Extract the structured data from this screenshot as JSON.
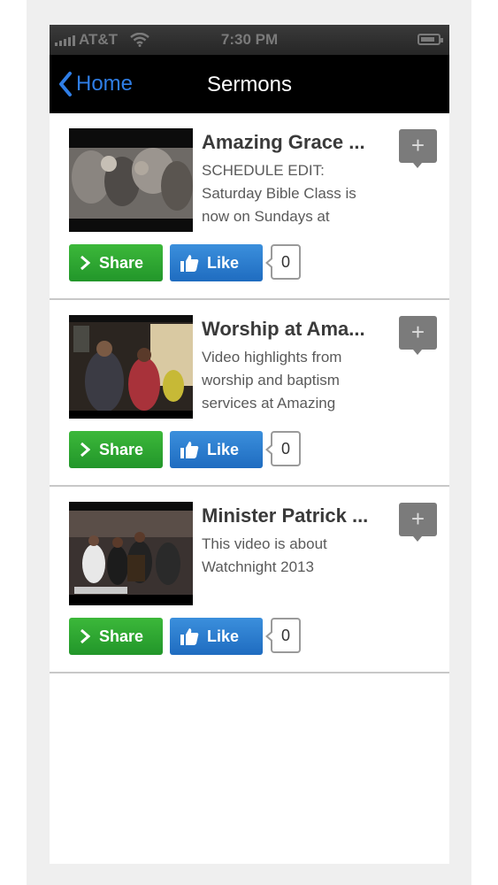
{
  "status_bar": {
    "carrier": "AT&T",
    "time": "7:30 PM",
    "icons": [
      "signal-icon",
      "wifi-icon",
      "battery-icon"
    ]
  },
  "nav": {
    "back_label": "Home",
    "title": "Sermons",
    "back_icon": "chevron-left-icon"
  },
  "colors": {
    "nav_bg": "#000000",
    "back_link": "#2f7ee6",
    "share_green": "#2ca634",
    "like_blue": "#2a7ccd",
    "add_gray": "#7b7b7b"
  },
  "sermons": [
    {
      "title": "Amazing Grace ...",
      "description": "SCHEDULE EDIT: Saturday Bible Class is now on Sundays at",
      "share_label": "Share",
      "like_label": "Like",
      "like_count": "0",
      "add_label": "+"
    },
    {
      "title": "Worship at Ama...",
      "description": "Video highlights from worship and baptism services at Amazing",
      "share_label": "Share",
      "like_label": "Like",
      "like_count": "0",
      "add_label": "+"
    },
    {
      "title": "Minister Patrick ...",
      "description": "This video is about Watchnight 2013",
      "share_label": "Share",
      "like_label": "Like",
      "like_count": "0",
      "add_label": "+"
    }
  ]
}
